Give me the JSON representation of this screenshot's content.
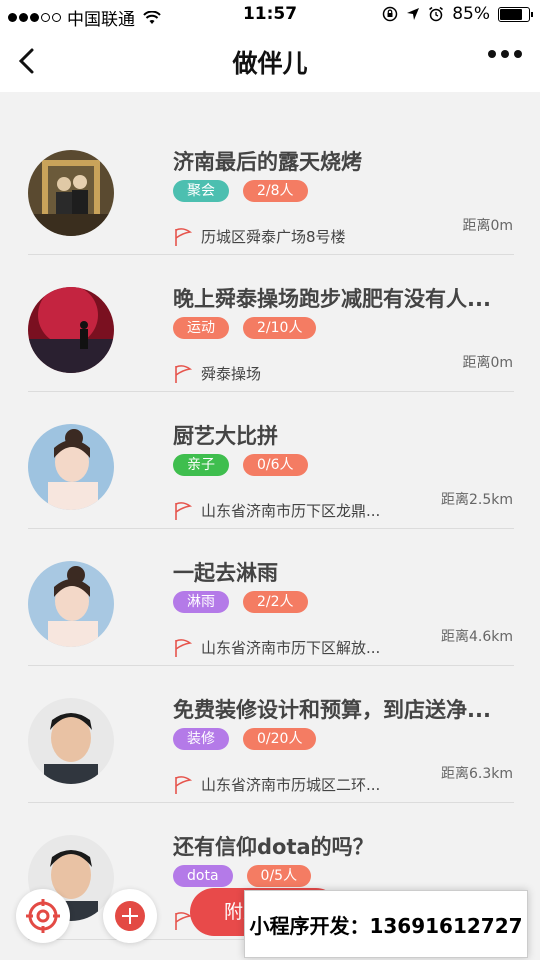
{
  "status_bar": {
    "carrier": "中国联通",
    "time": "11:57",
    "battery": "85%",
    "battery_level": 0.85
  },
  "nav": {
    "title": "做伴儿"
  },
  "items": [
    {
      "title": "济南最后的露天烧烤",
      "tag": "聚会",
      "tag_color": "#4cbfb0",
      "count": "2/8人",
      "address": "历城区舜泰广场8号楼",
      "distance": "距离0m"
    },
    {
      "title": "晚上舜泰操场跑步减肥有没有人...",
      "tag": "运动",
      "tag_color": "#f47c63",
      "count": "2/10人",
      "address": "舜泰操场",
      "distance": "距离0m"
    },
    {
      "title": "厨艺大比拼",
      "tag": "亲子",
      "tag_color": "#3fbe4e",
      "count": "0/6人",
      "address": "山东省济南市历下区龙鼎...",
      "distance": "距离2.5km"
    },
    {
      "title": "一起去淋雨",
      "tag": "淋雨",
      "tag_color": "#b47ae8",
      "count": "2/2人",
      "address": "山东省济南市历下区解放...",
      "distance": "距离4.6km"
    },
    {
      "title": "免费装修设计和预算，到店送净...",
      "tag": "装修",
      "tag_color": "#b47ae8",
      "count": "0/20人",
      "address": "山东省济南市历城区二环...",
      "distance": "距离6.3km"
    },
    {
      "title": "还有信仰dota的吗？",
      "tag": "dota",
      "tag_color": "#b47ae8",
      "count": "0/5人",
      "address": "",
      "distance": ""
    }
  ],
  "nearby_button": "附近",
  "promo_text": "小程序开发：13691612727"
}
